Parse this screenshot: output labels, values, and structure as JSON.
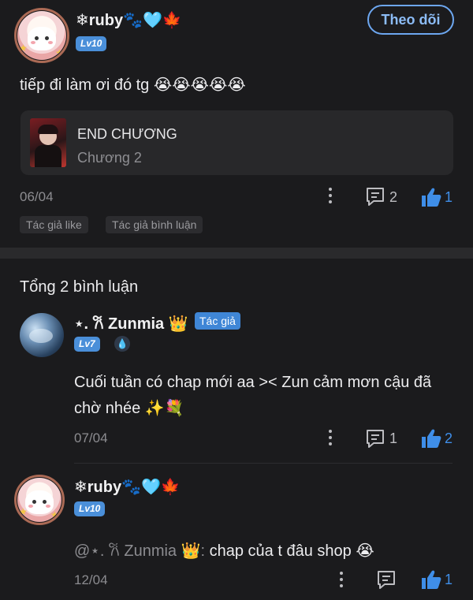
{
  "post": {
    "username": "❄ruby🐾🩵🍁",
    "level": "Lv10",
    "follow_label": "Theo dõi",
    "content": "tiếp đi làm ơi đó tg 😭😭😭😭😭",
    "story_card": {
      "title": "END CHƯƠNG",
      "subtitle": "Chương 2"
    },
    "date": "06/04",
    "comment_count": "2",
    "like_count": "1",
    "tags": [
      "Tác giả like",
      "Tác giả bình luận"
    ]
  },
  "comments_header": "Tổng 2 bình luận",
  "comments": [
    {
      "username": "⋆. 𐙚 Zunmia 👑",
      "badge": "Tác giả",
      "level": "Lv7",
      "content_line1": "Cuối tuần có chap mới aa >< Zun cảm mơn cậu đã",
      "content_line2": "chờ nhée ✨💐",
      "date": "07/04",
      "comment_count": "1",
      "like_count": "2"
    },
    {
      "username": "❄ruby🐾🩵🍁",
      "level": "Lv10",
      "mention": "@⋆. 𐙚 Zunmia 👑:",
      "content": "chap của t đâu shop 😭",
      "date": "12/04",
      "comment_count": "",
      "like_count": "1"
    }
  ],
  "colors": {
    "background": "#1b1b1d",
    "accent": "#3f8ee8",
    "level_badge": "#4a8fd9"
  },
  "icons": [
    "snowflake-icon",
    "paw-icon",
    "heart-icon",
    "leaf-icon",
    "more-dots-icon",
    "comment-icon",
    "thumbs-up-icon",
    "crown-icon",
    "drop-icon",
    "sparkles-icon",
    "bouquet-icon"
  ]
}
